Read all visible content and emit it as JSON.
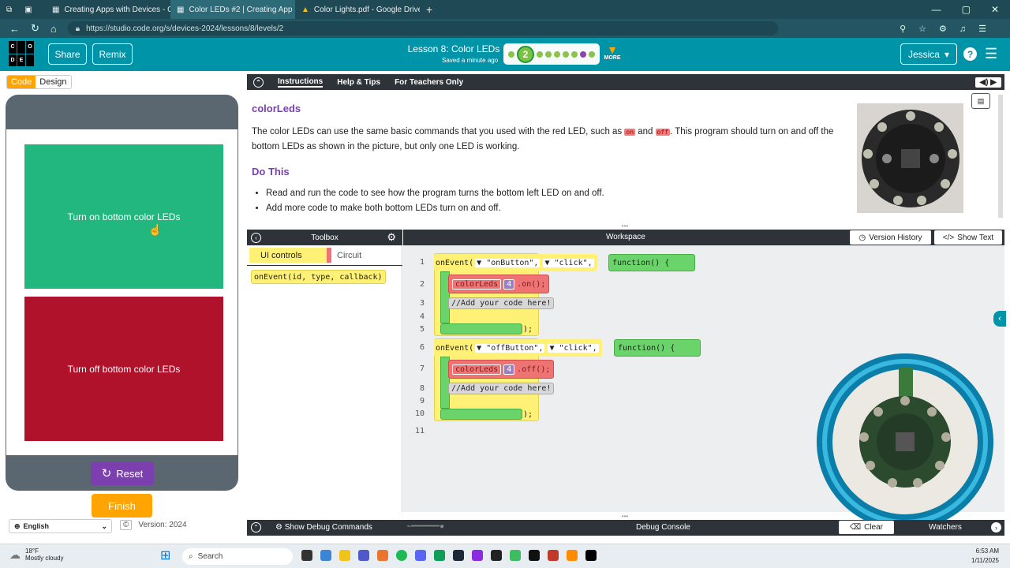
{
  "browser": {
    "tabs": [
      {
        "title": "Creating Apps with Devices - Circ",
        "active": false
      },
      {
        "title": "Color LEDs #2 | Creating App",
        "active": true
      },
      {
        "title": "Color Lights.pdf - Google Drive",
        "active": false
      }
    ],
    "url": "https://studio.code.org/s/devices-2024/lessons/8/levels/2"
  },
  "header": {
    "logo_letters": [
      "C",
      "O",
      "D",
      "E"
    ],
    "share_label": "Share",
    "remix_label": "Remix",
    "lesson_title": "Lesson 8: Color LEDs",
    "saved_text": "Saved a minute ago",
    "current_level": "2",
    "more_label": "MORE",
    "user_name": "Jessica",
    "help_label": "?"
  },
  "left": {
    "code_tab": "Code",
    "design_tab": "Design",
    "btn_on_label": "Turn on bottom color LEDs",
    "btn_off_label": "Turn off bottom color LEDs",
    "btn_on_color": "#22b77f",
    "btn_off_color": "#b0112b",
    "reset_label": "Reset",
    "finish_label": "Finish",
    "language": "English",
    "version_text": "Version: 2024"
  },
  "instructions": {
    "tabs": [
      "Instructions",
      "Help & Tips",
      "For Teachers Only"
    ],
    "heading": "colorLeds",
    "para_1": "The color LEDs can use the same basic commands that you used with the red LED, such as",
    "chip_on": "on",
    "para_and": "and",
    "chip_off": "off",
    "para_2": ". This program should turn on and off the bottom LEDs as shown in the picture, but only one LED is working.",
    "do_this": "Do This",
    "bullets": [
      "Read and run the code to see how the program turns the bottom left LED on and off.",
      "Add more code to make both bottom LEDs turn on and off."
    ]
  },
  "toolbox": {
    "title": "Toolbox",
    "tab_ui": "UI controls",
    "tab_circuit": "Circuit",
    "block": "onEvent(id, type, callback)"
  },
  "workspace": {
    "title": "Workspace",
    "version_history": "Version History",
    "show_text": "Show Text",
    "line_numbers": [
      "1",
      "2",
      "3",
      "4",
      "5",
      "6",
      "7",
      "8",
      "9",
      "10",
      "11"
    ],
    "on_event": "onEvent(",
    "on_id": "\"onButton\",",
    "off_id": "\"offButton\",",
    "event_type": "\"click\",",
    "func": "function() {",
    "color_leds": "colorLeds",
    "led_index": "4",
    "on_call": ".on();",
    "off_call": ".off();",
    "comment": "Add your code here!",
    "close": ");"
  },
  "debug": {
    "show_commands": "Show Debug Commands",
    "console": "Debug Console",
    "clear": "Clear",
    "watchers": "Watchers"
  },
  "taskbar": {
    "weather_temp": "18°F",
    "weather_desc": "Mostly cloudy",
    "search": "Search",
    "time": "6:53 AM",
    "date": "1/11/2025"
  }
}
